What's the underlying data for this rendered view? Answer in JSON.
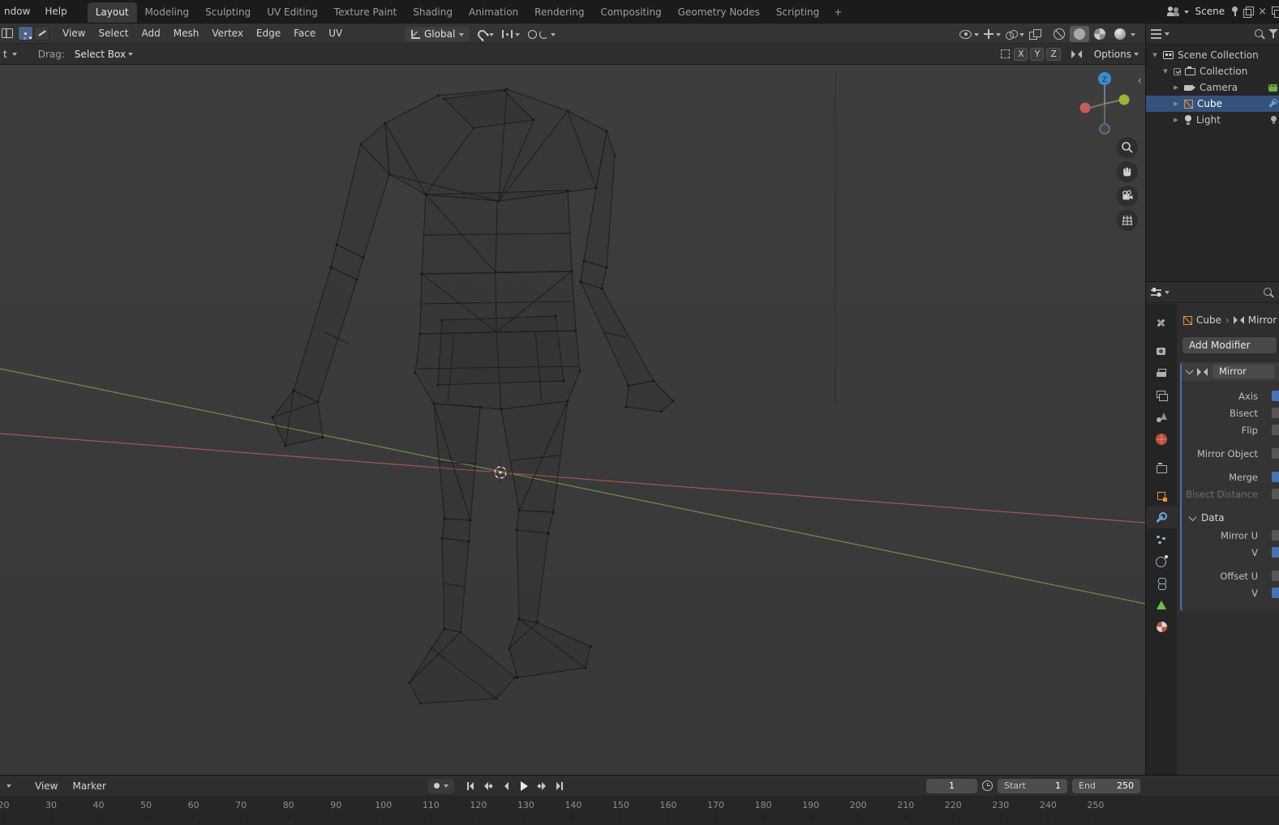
{
  "topbar": {
    "window_menus": [
      {
        "label": "ndow"
      },
      {
        "label": "Help"
      }
    ],
    "workspace_tabs": [
      "Layout",
      "Modeling",
      "Sculpting",
      "UV Editing",
      "Texture Paint",
      "Shading",
      "Animation",
      "Rendering",
      "Compositing",
      "Geometry Nodes",
      "Scripting"
    ],
    "active_tab": "Layout",
    "new_tab": "+",
    "scene": {
      "name": "Scene",
      "close": "×"
    }
  },
  "viewport_header": {
    "menus": [
      "View",
      "Select",
      "Add",
      "Mesh",
      "Vertex",
      "Edge",
      "Face",
      "UV"
    ],
    "orientation": {
      "value": "Global"
    }
  },
  "tool_settings": {
    "left_clip": "t",
    "drag_label": "Drag:",
    "drag_value": "Select Box",
    "axis_toggles": [
      "X",
      "Y",
      "Z"
    ],
    "options": "Options"
  },
  "viewport": {
    "gizmo_axis_label": "Z",
    "sidebar_arrow": "‹"
  },
  "outliner": {
    "rows": [
      {
        "label": "Scene Collection",
        "icon": "scene-collection",
        "indent": 0,
        "disclosure": "▼",
        "selected": false,
        "right_icons": []
      },
      {
        "label": "Collection",
        "icon": "collection",
        "indent": 1,
        "disclosure": "▼",
        "selected": false,
        "pre_icon": "checkbox",
        "right_icons": []
      },
      {
        "label": "Camera",
        "icon": "camera",
        "indent": 2,
        "disclosure": "▶",
        "selected": false,
        "right_icons": [
          "film"
        ]
      },
      {
        "label": "Cube",
        "icon": "cube",
        "indent": 2,
        "disclosure": "▶",
        "selected": true,
        "right_icons": [
          "wrench"
        ]
      },
      {
        "label": "Light",
        "icon": "light",
        "indent": 2,
        "disclosure": "▶",
        "selected": false,
        "right_icons": [
          "bulb"
        ]
      }
    ]
  },
  "properties": {
    "tabs": [
      {
        "id": "tool",
        "icon": "tool",
        "gap": false,
        "active": false
      },
      {
        "id": "render",
        "icon": "render",
        "gap": true,
        "active": false
      },
      {
        "id": "output",
        "icon": "output",
        "gap": false,
        "active": false
      },
      {
        "id": "view-layer",
        "icon": "viewlayer",
        "gap": false,
        "active": false
      },
      {
        "id": "scene",
        "icon": "scene",
        "gap": false,
        "active": false
      },
      {
        "id": "world",
        "icon": "world",
        "gap": false,
        "active": false
      },
      {
        "id": "collection",
        "icon": "collection",
        "gap": true,
        "active": false
      },
      {
        "id": "object",
        "icon": "object",
        "gap": true,
        "active": false
      },
      {
        "id": "modifiers",
        "icon": "modifiers",
        "gap": false,
        "active": true
      },
      {
        "id": "particles",
        "icon": "particles",
        "gap": false,
        "active": false
      },
      {
        "id": "physics",
        "icon": "physics",
        "gap": false,
        "active": false
      },
      {
        "id": "constraints",
        "icon": "constraints",
        "gap": false,
        "active": false
      },
      {
        "id": "data",
        "icon": "data",
        "gap": false,
        "active": false
      },
      {
        "id": "material",
        "icon": "material",
        "gap": false,
        "active": false
      }
    ],
    "breadcrumb": {
      "object": "Cube",
      "separator": "›",
      "modifier": "Mirror"
    },
    "add_modifier": "Add Modifier",
    "modifier": {
      "name": "Mirror",
      "rows": [
        {
          "label": "Axis",
          "sliver": "blue",
          "space": false,
          "disabled": false
        },
        {
          "label": "Bisect",
          "sliver": "gray",
          "space": false,
          "disabled": false
        },
        {
          "label": "Flip",
          "sliver": "gray",
          "space": false,
          "disabled": false
        },
        {
          "label": "Mirror Object",
          "sliver": "gray",
          "space": true,
          "disabled": false
        },
        {
          "label": "Merge",
          "sliver": "blue",
          "space": true,
          "disabled": false
        },
        {
          "label": "Bisect Distance",
          "sliver": "gray",
          "space": false,
          "disabled": true
        }
      ],
      "data_label": "Data",
      "data_rows": [
        {
          "label": "Mirror U",
          "sliver": "gray",
          "space": false,
          "disabled": false
        },
        {
          "label": "V",
          "sliver": "blue",
          "space": false,
          "disabled": false
        },
        {
          "label": "Offset U",
          "sliver": "gray",
          "space": true,
          "disabled": false
        },
        {
          "label": "V",
          "sliver": "blue",
          "space": false,
          "disabled": false
        }
      ]
    }
  },
  "timeline": {
    "menus": [
      "View",
      "Marker"
    ],
    "current_frame": "1",
    "start": {
      "label": "Start",
      "value": "1"
    },
    "end": {
      "label": "End",
      "value": "250"
    },
    "ruler_frames": [
      20,
      30,
      40,
      50,
      60,
      70,
      80,
      90,
      100,
      110,
      120,
      130,
      140,
      150,
      160,
      170,
      180,
      190,
      200,
      210,
      220,
      230,
      240,
      250
    ]
  }
}
